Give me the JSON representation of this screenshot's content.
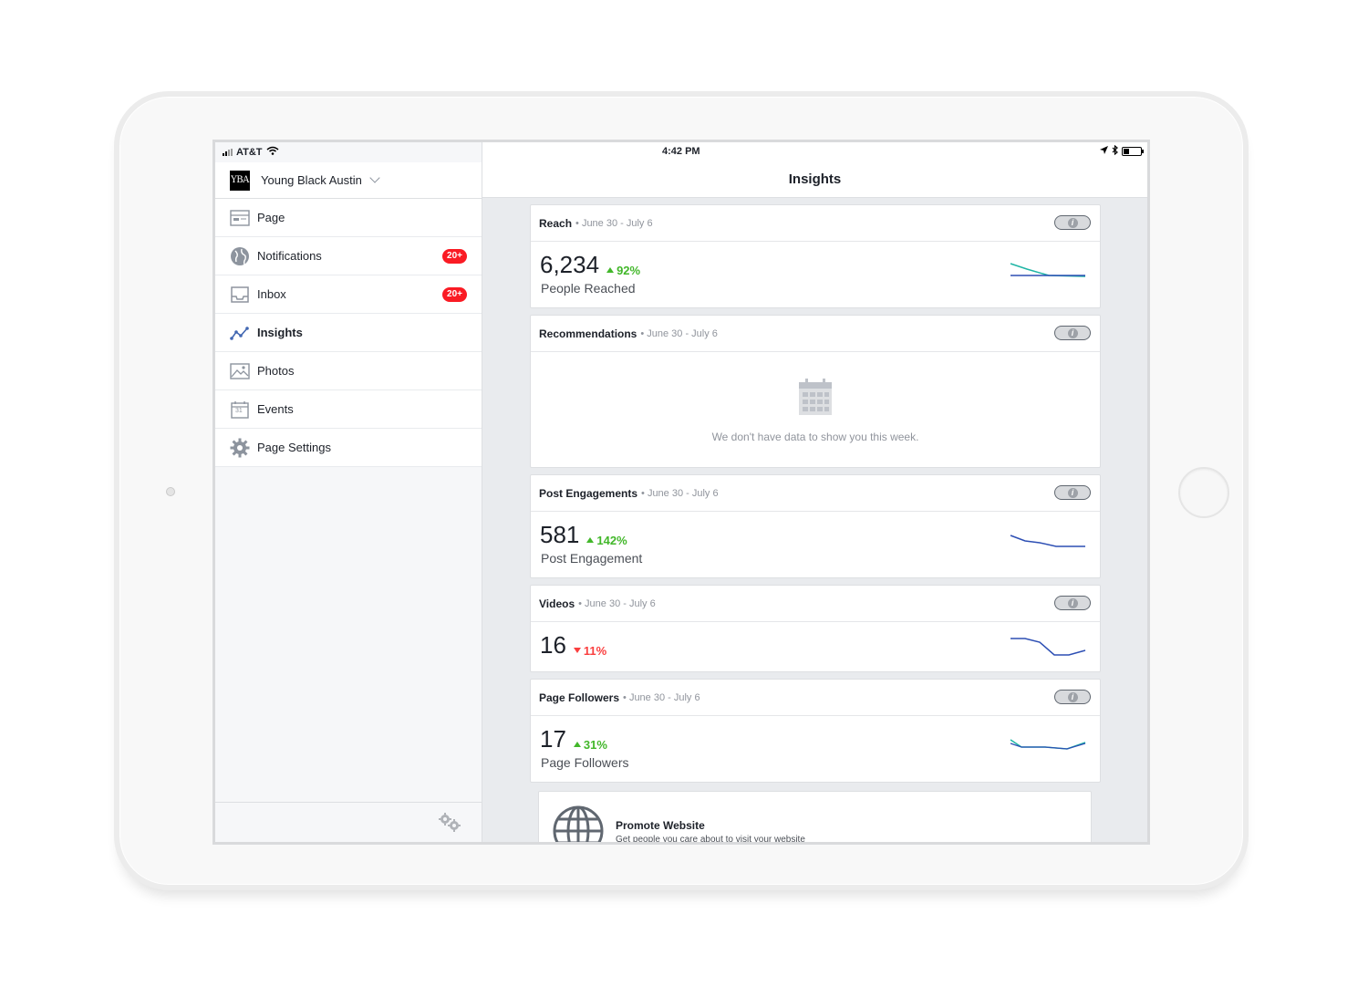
{
  "status_bar": {
    "carrier": "AT&T",
    "time": "4:42 PM"
  },
  "page": {
    "logo_text": "YBA",
    "name": "Young Black Austin"
  },
  "sidebar": {
    "items": [
      {
        "label": "Page",
        "icon": "page-icon"
      },
      {
        "label": "Notifications",
        "icon": "globe-icon",
        "badge": "20+"
      },
      {
        "label": "Inbox",
        "icon": "inbox-icon",
        "badge": "20+"
      },
      {
        "label": "Insights",
        "icon": "insights-icon",
        "active": true
      },
      {
        "label": "Photos",
        "icon": "photos-icon"
      },
      {
        "label": "Events",
        "icon": "calendar-icon",
        "icon_text": "31"
      },
      {
        "label": "Page Settings",
        "icon": "gear-icon"
      }
    ]
  },
  "header": {
    "title": "Insights"
  },
  "cards": {
    "reach": {
      "title": "Reach",
      "date": "• June 30 - July 6",
      "value": "6,234",
      "change": "92%",
      "label": "People Reached"
    },
    "recommendations": {
      "title": "Recommendations",
      "date": "• June 30 - July 6",
      "empty_text": "We don't have data to show you this week."
    },
    "post_engagements": {
      "title": "Post Engagements",
      "date": "• June 30 - July 6",
      "value": "581",
      "change": "142%",
      "label": "Post Engagement"
    },
    "videos": {
      "title": "Videos",
      "date": "• June 30 - July 6",
      "value": "16",
      "change": "11%"
    },
    "page_followers": {
      "title": "Page Followers",
      "date": "• June 30 - July 6",
      "value": "17",
      "change": "31%",
      "label": "Page Followers"
    }
  },
  "promo": {
    "title": "Promote Website",
    "subtitle": "Get people you care about to visit your website"
  },
  "colors": {
    "positive": "#42b72a",
    "negative": "#fa3e3e",
    "badge": "#fa1b24",
    "spark_blue": "#2d4fb4",
    "spark_teal": "#1fb5a5"
  }
}
